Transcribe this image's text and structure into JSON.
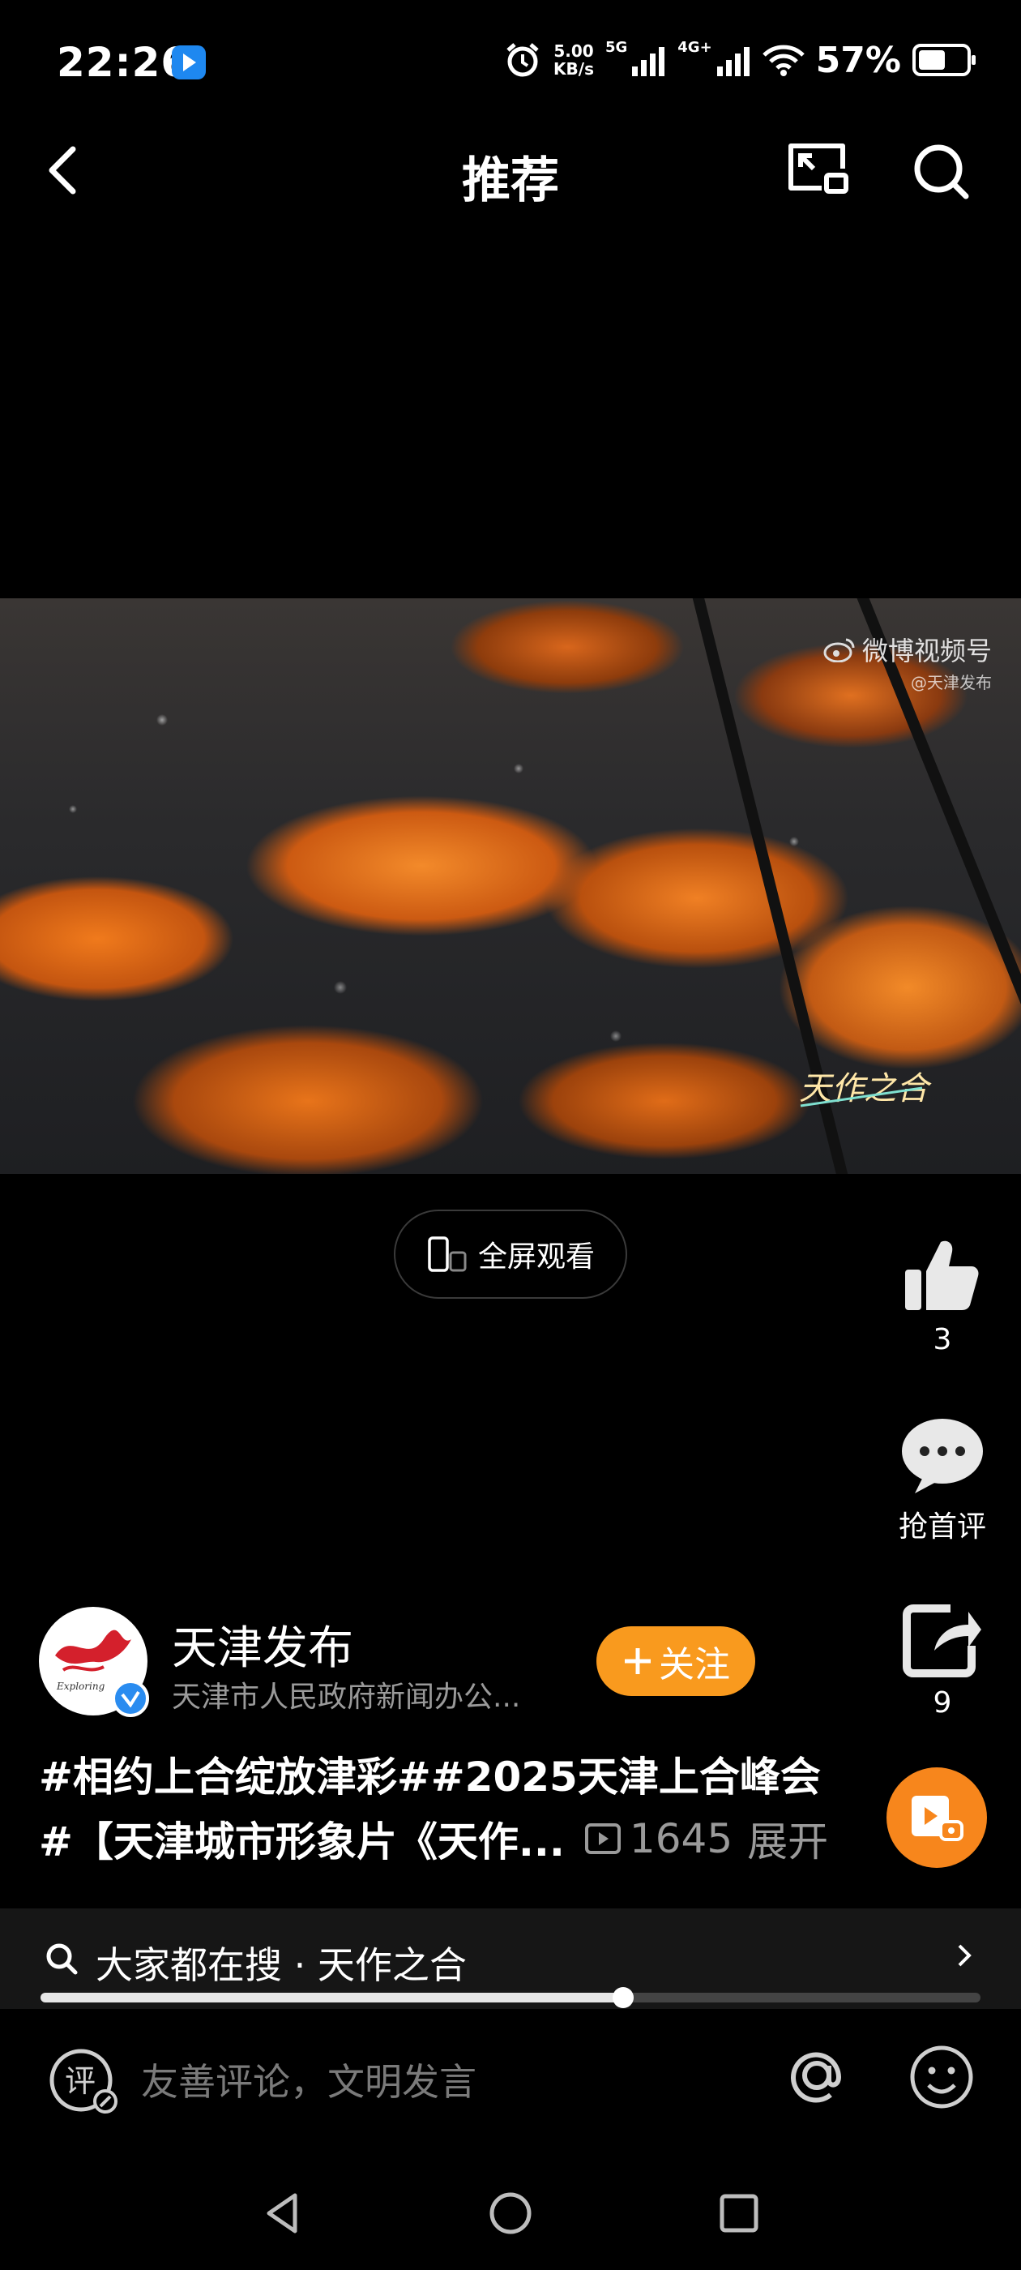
{
  "status_bar": {
    "time": "22:26",
    "net_speed_value": "5.00",
    "net_speed_unit": "KB/s",
    "net_5g": "5G",
    "net_4g": "4G+",
    "battery": "57%",
    "battery_level": 0.57
  },
  "nav": {
    "title": "推荐"
  },
  "video": {
    "watermark_title": "微博视频号",
    "watermark_sub": "@天津发布",
    "brand_logo_text": "天作之合"
  },
  "fullscreen": {
    "label": "全屏观看"
  },
  "actions": {
    "like_count": "3",
    "comment_label": "抢首评",
    "share_count": "9"
  },
  "author": {
    "name": "天津发布",
    "description": "天津市人民政府新闻办公...",
    "follow_label": "关注"
  },
  "post": {
    "hashtags": "#相约上合绽放津彩##2025天津上合峰会",
    "caption": "#【天津城市形象片《天作...",
    "views": "1645",
    "expand_label": "展开"
  },
  "search_suggest": {
    "text": "大家都在搜 · 天作之合"
  },
  "playback": {
    "progress": 0.62
  },
  "comment_bar": {
    "placeholder": "友善评论，文明发言",
    "comment_icon_char": "评"
  },
  "colors": {
    "accent_orange": "#f99a1e",
    "background": "#000000",
    "muted_text": "#9a9a9a"
  }
}
